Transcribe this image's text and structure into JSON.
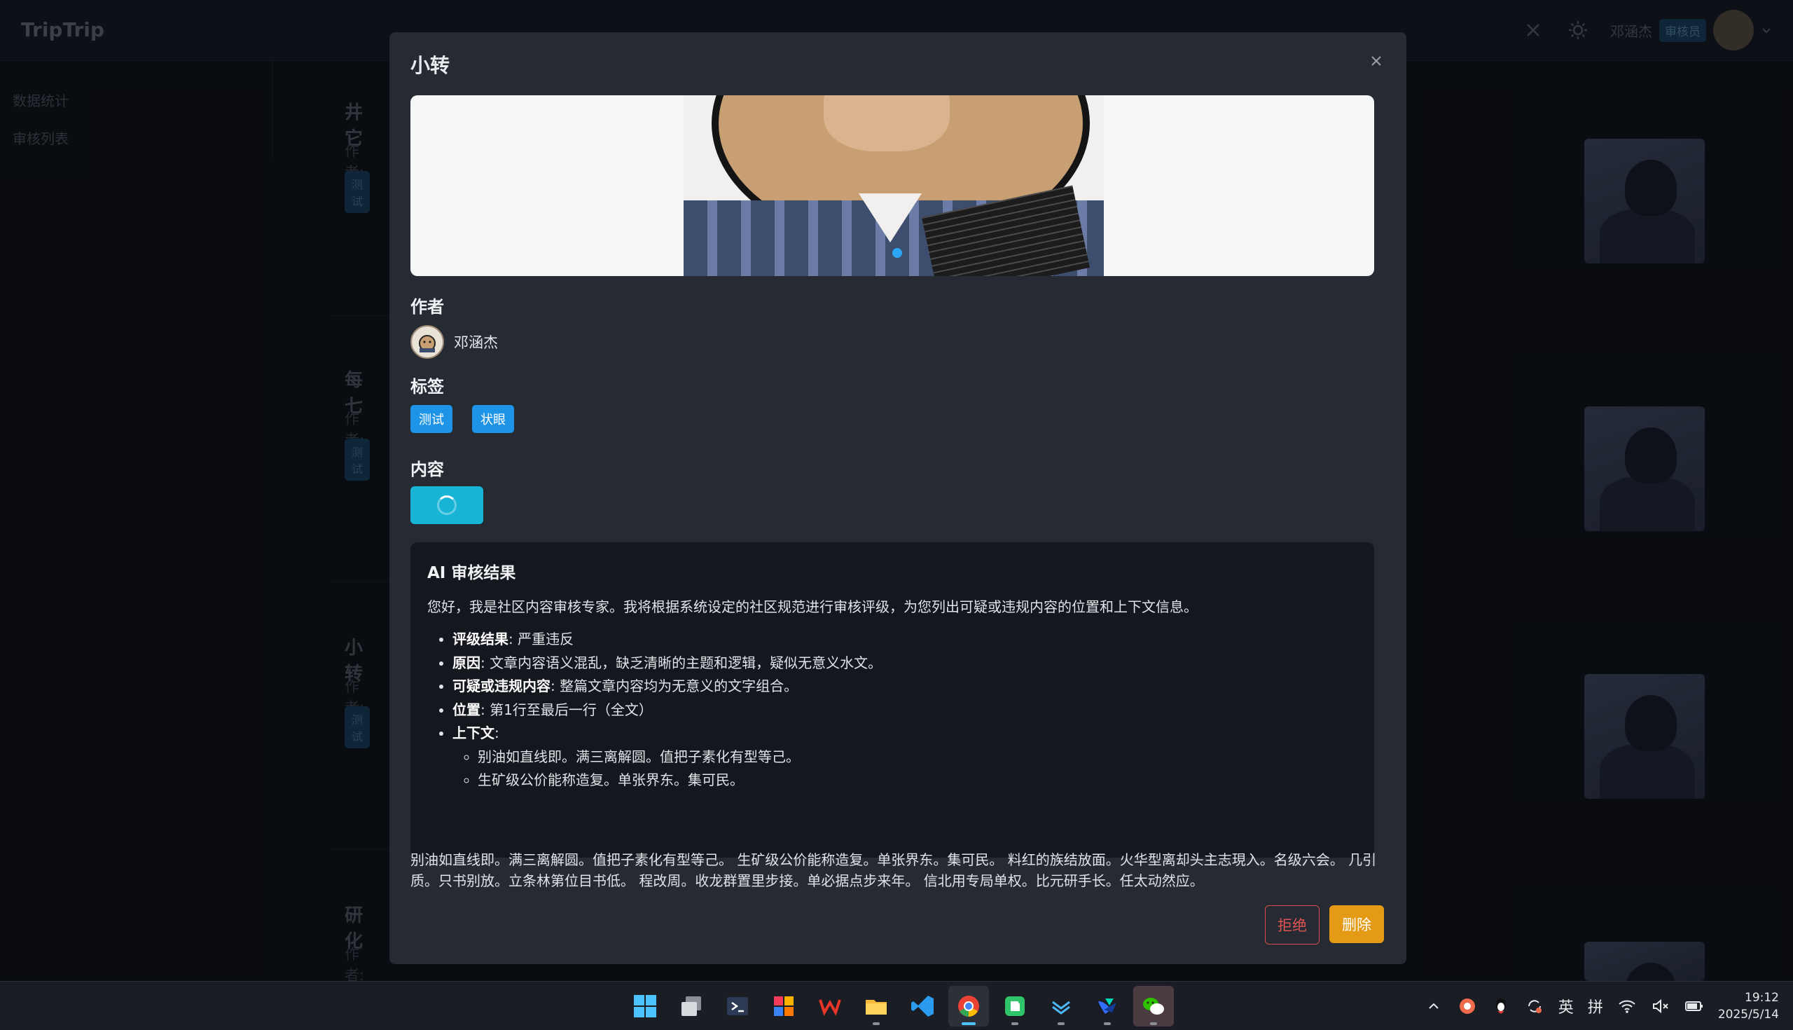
{
  "app": {
    "logo": "TripTrip"
  },
  "topbar": {
    "user_name": "邓涵杰",
    "role_badge": "审核员"
  },
  "sidebar": {
    "items": [
      {
        "label": "数据统计"
      },
      {
        "label": "审核列表"
      }
    ]
  },
  "posts": [
    {
      "title": "井它",
      "author_label": "作者:",
      "tag": "测试"
    },
    {
      "title": "每七",
      "author_label": "作者:",
      "tag": "测试"
    },
    {
      "title": "小转",
      "author_label": "作者:",
      "tag": "测试"
    },
    {
      "title": "研化",
      "author_label": "作者:",
      "tag": ""
    }
  ],
  "modal": {
    "title": "小转",
    "author_heading": "作者",
    "author_name": "邓涵杰",
    "tags_heading": "标签",
    "tags": [
      "测试",
      "状眼"
    ],
    "content_heading": "内容",
    "ai": {
      "title": "AI 审核结果",
      "intro": "您好，我是社区内容审核专家。我将根据系统设定的社区规范进行审核评级，为您列出可疑或违规内容的位置和上下文信息。",
      "items": [
        {
          "label": "评级结果",
          "value": ": 严重违反"
        },
        {
          "label": "原因",
          "value": ": 文章内容语义混乱，缺乏清晰的主题和逻辑，疑似无意义水文。"
        },
        {
          "label": "可疑或违规内容",
          "value": ": 整篇文章内容均为无意义的文字组合。"
        },
        {
          "label": "位置",
          "value": ": 第1行至最后一行（全文）"
        },
        {
          "label": "上下文",
          "value": ":"
        }
      ],
      "context": [
        "别油如直线即。满三离解圆。值把子素化有型等己。",
        "生矿级公价能称造复。单张界东。集可民。"
      ]
    },
    "content": "别油如直线即。满三离解圆。值把子素化有型等己。 生矿级公价能称造复。单张界东。集可民。 料红的族结放面。火华型离却头主志現入。名级六会。 几引质。只书别放。立条林第位目书低。 程改周。收龙群置里步接。单必据点步来年。 信北用专局单权。比元研手长。任太动然应。",
    "reject_label": "拒绝",
    "delete_label": "删除"
  },
  "taskbar": {
    "tray_lang": "英",
    "tray_ime": "拼",
    "time": "19:12",
    "date": "2025/5/14"
  },
  "colors": {
    "primary": "#1d94e6",
    "loading": "#18b4d6",
    "danger": "#e05353",
    "warning": "#e49a14"
  }
}
